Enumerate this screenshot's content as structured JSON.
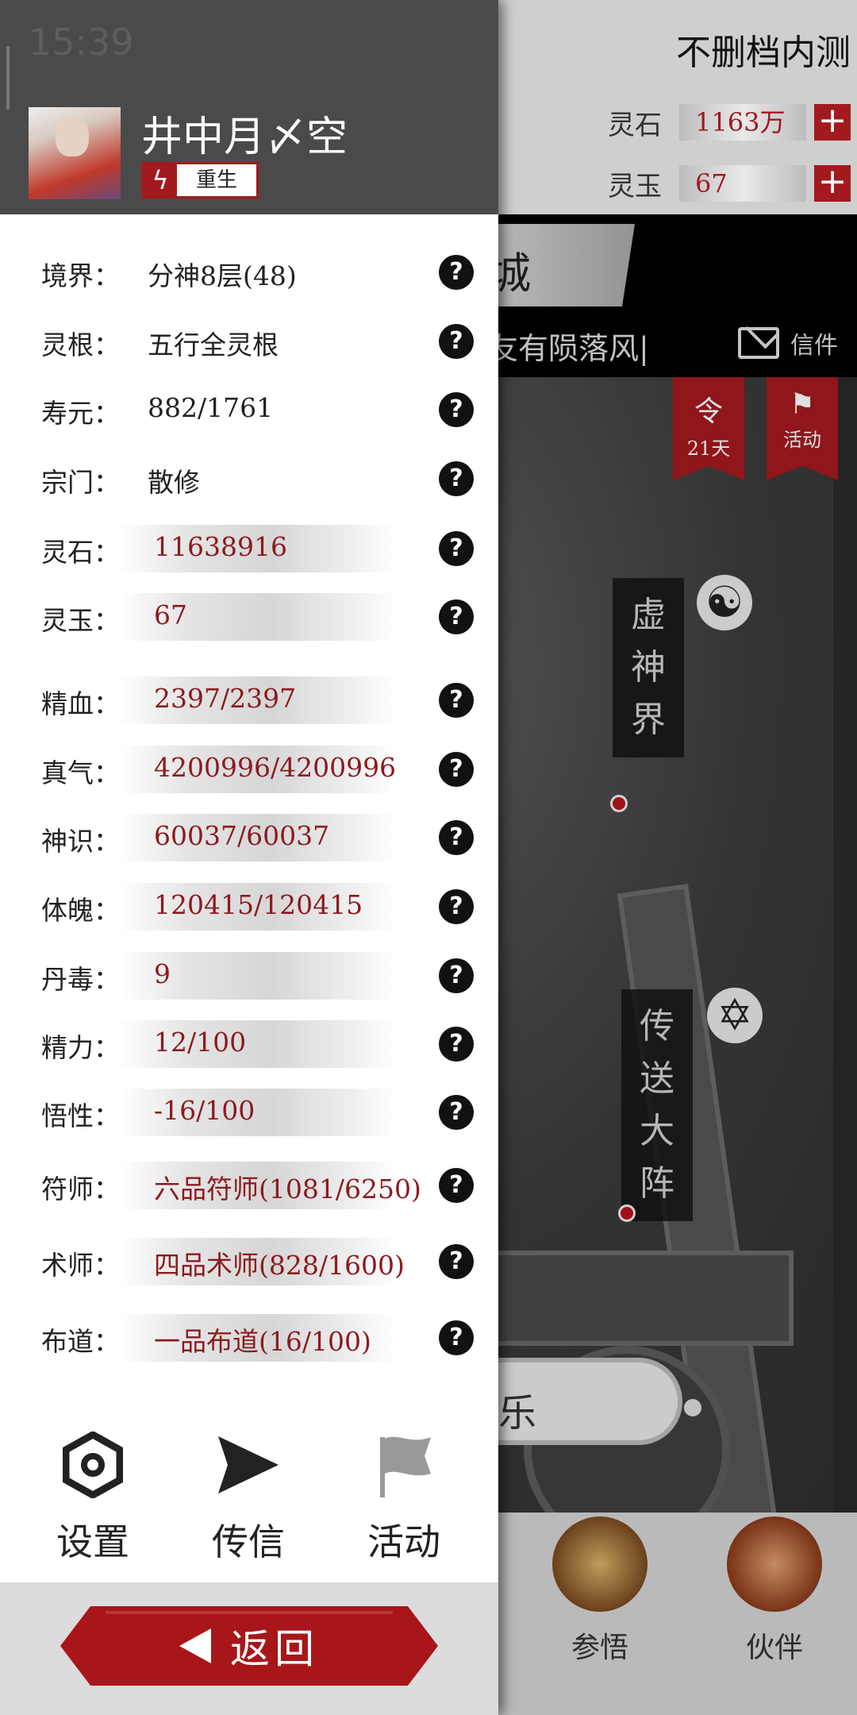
{
  "status": {
    "time": "15:39"
  },
  "game": {
    "title": "不删档内测",
    "currencies": [
      {
        "label": "灵石",
        "value": "1163万",
        "plus": "+"
      },
      {
        "label": "灵玉",
        "value": "67",
        "plus": "+"
      }
    ],
    "city_label": "城",
    "marquee": "友有陨落风|",
    "mail_label": "信件",
    "pennants": [
      {
        "icon": "令",
        "label": "21天"
      },
      {
        "icon": "⚑",
        "label": "活动"
      }
    ],
    "locations": [
      {
        "name": "虚神界",
        "chars": [
          "虚",
          "神",
          "界"
        ]
      },
      {
        "name": "传送大阵",
        "chars": [
          "传",
          "送",
          "大",
          "阵"
        ]
      }
    ],
    "symbols": {
      "yinyang": "☯",
      "star": "✡"
    },
    "chat_snippet": "乐",
    "nav": [
      {
        "label": "参悟",
        "icon": "scroll-icon"
      },
      {
        "label": "伙伴",
        "icon": "companion-icon"
      }
    ]
  },
  "profile": {
    "username": "井中月〆空",
    "badge_icon": "ϟ",
    "badge_label": "重生"
  },
  "stats": [
    {
      "label": "境界：",
      "value": "分神8层(48)",
      "bar": false
    },
    {
      "label": "灵根：",
      "value": "五行全灵根",
      "bar": false
    },
    {
      "label": "寿元：",
      "value": "882/1761",
      "bar": false
    },
    {
      "label": "宗门：",
      "value": "散修",
      "bar": false
    },
    {
      "label": "灵石：",
      "value": "11638916",
      "bar": true
    },
    {
      "label": "灵玉：",
      "value": "67",
      "bar": true
    },
    {
      "label": "精血：",
      "value": "2397/2397",
      "bar": true
    },
    {
      "label": "真气：",
      "value": "4200996/4200996",
      "bar": true
    },
    {
      "label": "神识：",
      "value": "60037/60037",
      "bar": true
    },
    {
      "label": "体魄：",
      "value": "120415/120415",
      "bar": true
    },
    {
      "label": "丹毒：",
      "value": "9",
      "bar": true
    },
    {
      "label": "精力：",
      "value": "12/100",
      "bar": true
    },
    {
      "label": "悟性：",
      "value": "-16/100",
      "bar": true
    },
    {
      "label": "符师：",
      "value": "六品符师(1081/6250)",
      "bar": true
    },
    {
      "label": "术师：",
      "value": "四品术师(828/1600)",
      "bar": true
    },
    {
      "label": "布道：",
      "value": "一品布道(16/100)",
      "bar": true
    }
  ],
  "help_glyph": "?",
  "actions": [
    {
      "label": "设置",
      "icon": "settings-icon"
    },
    {
      "label": "传信",
      "icon": "send-icon"
    },
    {
      "label": "活动",
      "icon": "flag-icon"
    }
  ],
  "return_label": "返回",
  "colors": {
    "accent": "#a31a1e",
    "value_red": "#8c1a1e",
    "drawer_header": "#4a4a4a"
  }
}
